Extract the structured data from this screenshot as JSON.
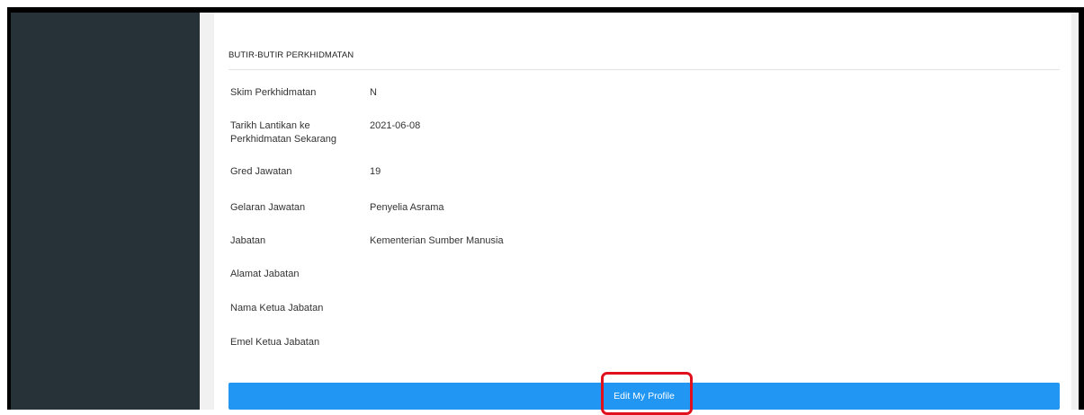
{
  "section": {
    "title": "BUTIR-BUTIR PERKHIDMATAN"
  },
  "fields": [
    {
      "label": "Skim Perkhidmatan",
      "value": "N"
    },
    {
      "label": "Tarikh Lantikan ke Perkhidmatan Sekarang",
      "value": "2021-06-08"
    },
    {
      "label": "Gred Jawatan",
      "value": "19"
    },
    {
      "label": "Gelaran Jawatan",
      "value": "Penyelia Asrama"
    },
    {
      "label": "Jabatan",
      "value": "Kementerian Sumber Manusia"
    },
    {
      "label": "Alamat Jabatan",
      "value": ""
    },
    {
      "label": "Nama Ketua Jabatan",
      "value": ""
    },
    {
      "label": "Emel Ketua Jabatan",
      "value": ""
    }
  ],
  "actions": {
    "edit_profile_label": "Edit My Profile"
  },
  "colors": {
    "sidebar": "#263238",
    "button": "#2196f3",
    "highlight": "#e0101c"
  }
}
